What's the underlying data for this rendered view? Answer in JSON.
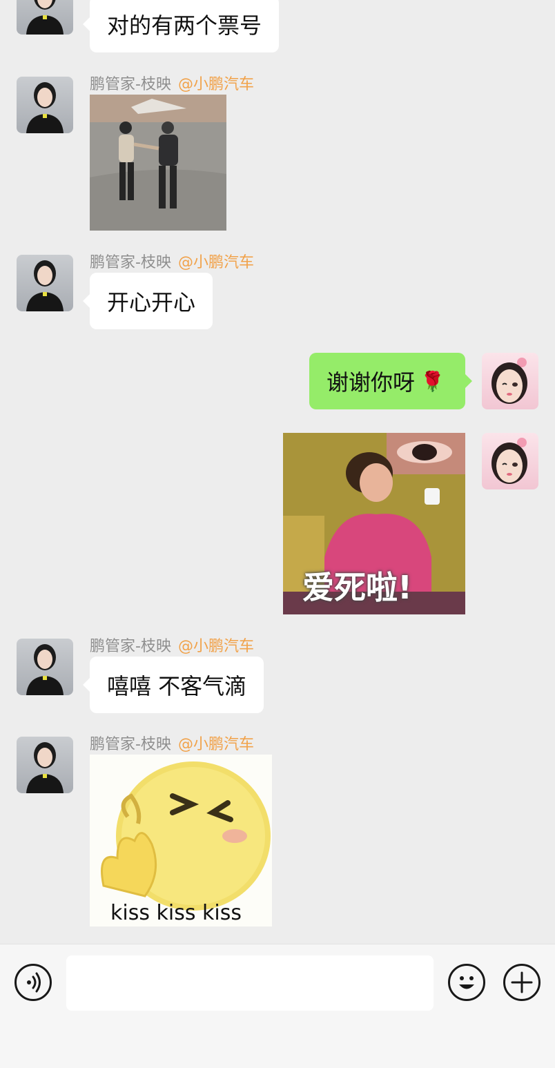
{
  "messages": [
    {
      "text": "对的有两个票号"
    },
    {
      "sender": "鹏管家-枝映",
      "mention": "@小鹏汽车",
      "type": "image",
      "icon": "dancing-people-gif"
    },
    {
      "sender": "鹏管家-枝映",
      "mention": "@小鹏汽车",
      "text": "开心开心"
    },
    {
      "text": "谢谢你呀",
      "emoji": "🌹"
    },
    {
      "type": "sticker",
      "caption": "爱死啦!"
    },
    {
      "sender": "鹏管家-枝映",
      "mention": "@小鹏汽车",
      "text": "嘻嘻 不客气滴"
    },
    {
      "sender": "鹏管家-枝映",
      "mention": "@小鹏汽车",
      "type": "sticker",
      "caption": "kiss kiss kiss"
    }
  ],
  "input": {
    "placeholder": ""
  },
  "icons": {
    "voice": "voice-icon",
    "emoji": "smiley-icon",
    "more": "plus-icon"
  },
  "colors": {
    "my_bubble": "#95ec69",
    "their_bubble": "#ffffff",
    "mention": "#f1a24a",
    "background": "#ededed"
  }
}
